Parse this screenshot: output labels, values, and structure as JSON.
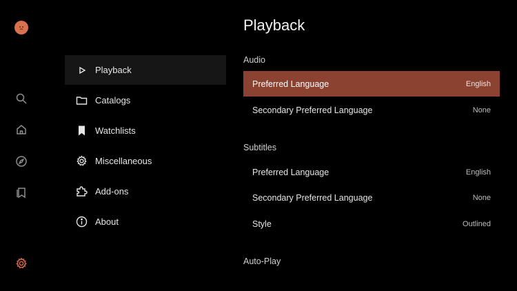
{
  "rail": {
    "icons": [
      "avatar-icon",
      "search-icon",
      "home-icon",
      "compass-icon",
      "library-icon",
      "gear-icon"
    ],
    "active_color": "#d36a48"
  },
  "menu": {
    "items": [
      {
        "label": "Playback",
        "icon": "play-icon"
      },
      {
        "label": "Catalogs",
        "icon": "folder-icon"
      },
      {
        "label": "Watchlists",
        "icon": "bookmark-icon"
      },
      {
        "label": "Miscellaneous",
        "icon": "gear-icon"
      },
      {
        "label": "Add-ons",
        "icon": "puzzle-icon"
      },
      {
        "label": "About",
        "icon": "info-icon"
      }
    ]
  },
  "main": {
    "title": "Playback",
    "audio": {
      "title": "Audio",
      "rows": [
        {
          "label": "Preferred Language",
          "value": "English"
        },
        {
          "label": "Secondary Preferred Language",
          "value": "None"
        }
      ]
    },
    "subtitles": {
      "title": "Subtitles",
      "rows": [
        {
          "label": "Preferred Language",
          "value": "English"
        },
        {
          "label": "Secondary Preferred Language",
          "value": "None"
        },
        {
          "label": "Style",
          "value": "Outlined"
        }
      ]
    },
    "autoplay": {
      "title": "Auto-Play"
    }
  },
  "colors": {
    "background": "#000000",
    "focus_row": "#8b4231",
    "selected_menu": "#161616"
  }
}
